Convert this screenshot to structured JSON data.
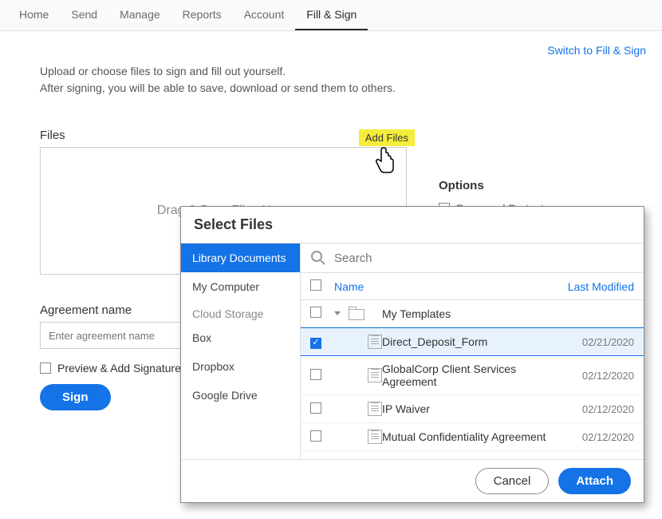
{
  "nav": {
    "tabs": [
      "Home",
      "Send",
      "Manage",
      "Reports",
      "Account",
      "Fill & Sign"
    ],
    "active": "Fill & Sign",
    "switch_link": "Switch to Fill & Sign"
  },
  "intro": {
    "line1": "Upload or choose files to sign and fill out yourself.",
    "line2": "After signing, you will be able to save, download or send them to others."
  },
  "files": {
    "label": "Files",
    "add_files": "Add Files",
    "dropzone": "Drag & Drop Files Here"
  },
  "options": {
    "title": "Options",
    "password_protect": "Password Protect"
  },
  "agreement": {
    "label": "Agreement name",
    "placeholder": "Enter agreement name",
    "preview": "Preview & Add Signature Fields",
    "sign": "Sign"
  },
  "modal": {
    "title": "Select Files",
    "sidebar": {
      "items": [
        "Library Documents",
        "My Computer"
      ],
      "cloud_label": "Cloud Storage",
      "cloud_items": [
        "Box",
        "Dropbox",
        "Google Drive"
      ],
      "active": "Library Documents"
    },
    "search_placeholder": "Search",
    "columns": {
      "name": "Name",
      "modified": "Last Modified"
    },
    "folder": "My Templates",
    "files": [
      {
        "name": "Direct_Deposit_Form",
        "date": "02/21/2020",
        "checked": true
      },
      {
        "name": "GlobalCorp Client Services Agreement",
        "date": "02/12/2020",
        "checked": false
      },
      {
        "name": "IP Waiver",
        "date": "02/12/2020",
        "checked": false
      },
      {
        "name": "Mutual Confidentiality Agreement",
        "date": "02/12/2020",
        "checked": false
      }
    ],
    "cancel": "Cancel",
    "attach": "Attach"
  }
}
